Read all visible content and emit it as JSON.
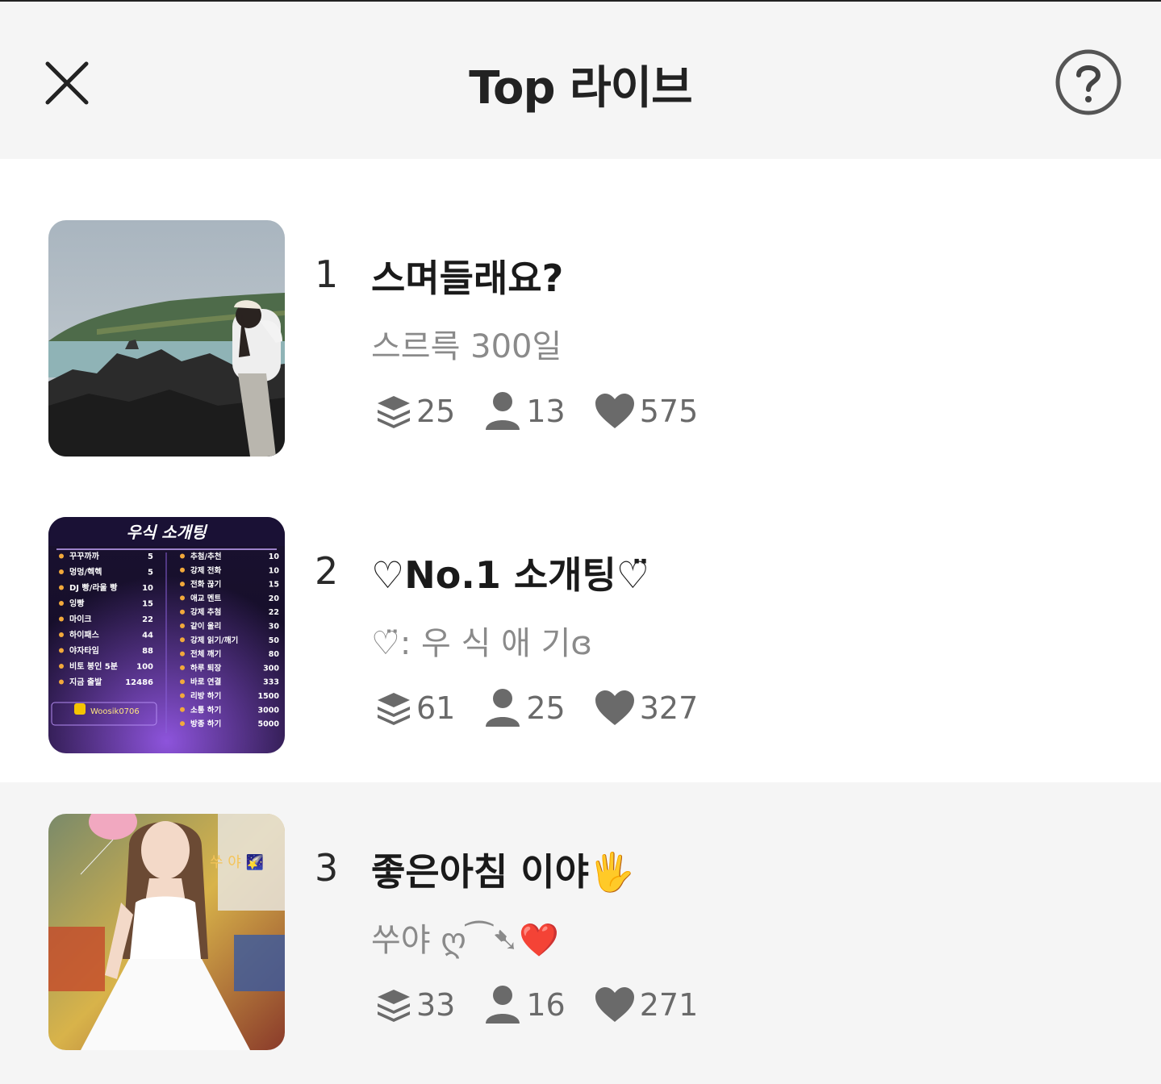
{
  "header": {
    "title": "Top 라이브"
  },
  "items": [
    {
      "rank": "1",
      "name": "스며들래요?",
      "subtitle": "스르륵 300일",
      "stack_count": "25",
      "viewer_count": "13",
      "like_count": "575"
    },
    {
      "rank": "2",
      "name": "♡No.1 소개팅♡̈",
      "subtitle": "♡̈: 우 식 애 기ɞ",
      "stack_count": "61",
      "viewer_count": "25",
      "like_count": "327",
      "poster": {
        "title": "우식 소개팅",
        "handle": "Woosik0706",
        "left_menu": [
          [
            "꾸꾸까까",
            "5"
          ],
          [
            "멍멍/헥헥",
            "5"
          ],
          [
            "DJ 빵/라울 빵",
            "10"
          ],
          [
            "잉빵",
            "15"
          ],
          [
            "마이크",
            "22"
          ],
          [
            "하이패스",
            "44"
          ],
          [
            "야자타임",
            "88"
          ],
          [
            "비토 봉인 5분",
            "100"
          ],
          [
            "지금 출발",
            "12486"
          ]
        ],
        "right_menu": [
          [
            "추첨/추천",
            "10"
          ],
          [
            "강제 전화",
            "10"
          ],
          [
            "전화 끊기",
            "15"
          ],
          [
            "애교 멘트",
            "20"
          ],
          [
            "강제 추첨",
            "22"
          ],
          [
            "같이 울리",
            "30"
          ],
          [
            "강제 읽기/깨기",
            "50"
          ],
          [
            "전체 깨기",
            "80"
          ],
          [
            "하루 퇴장",
            "300"
          ],
          [
            "바로 연결",
            "333"
          ],
          [
            "리방 하기",
            "1500"
          ],
          [
            "소통 하기",
            "3000"
          ],
          [
            "방종 하기",
            "5000"
          ]
        ]
      }
    },
    {
      "rank": "3",
      "name": "좋은아침 이야🖐",
      "subtitle": "쑤야 ღ⁀➷❤️",
      "stack_count": "33",
      "viewer_count": "16",
      "like_count": "271",
      "thumb_caption": "쑤 야 🌠"
    }
  ],
  "colors": {
    "header_bg": "#f5f5f5",
    "highlight_row_bg": "#f5f5f5",
    "stat_icon": "#6a6a6a",
    "subtitle": "#8a8a8a"
  },
  "icons": {
    "close": "close-icon",
    "help": "help-icon",
    "stack": "layers-icon",
    "viewer": "person-icon",
    "like": "heart-icon"
  }
}
